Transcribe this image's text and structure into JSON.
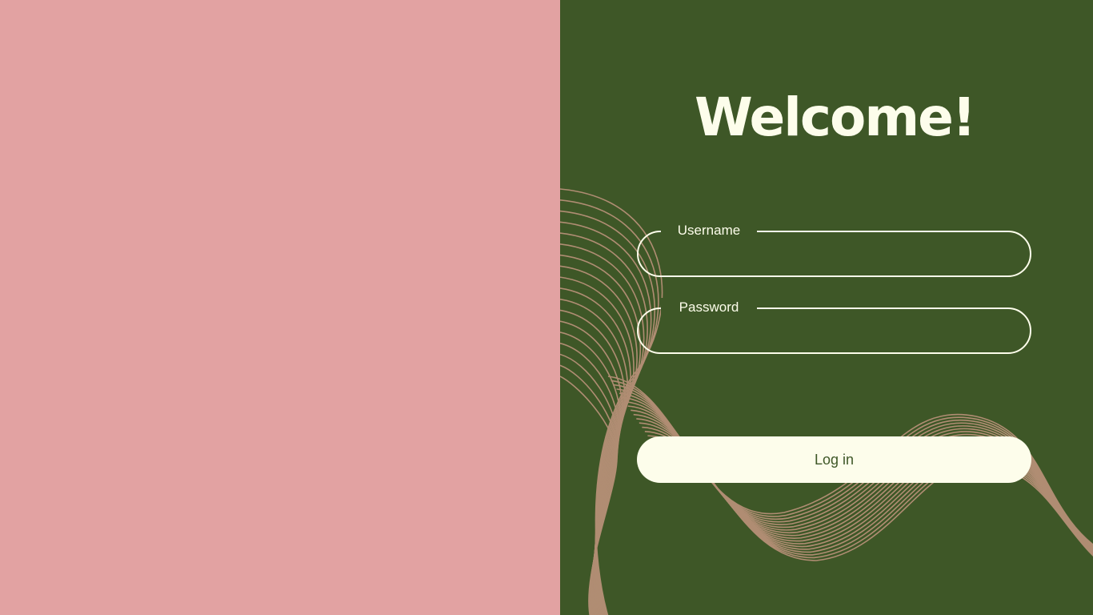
{
  "colors": {
    "left_panel_bg": "#e2a2a2",
    "right_panel_bg": "#3e5727",
    "cream": "#fdfdeb",
    "wave_lines": "#b08d73"
  },
  "decoration": {
    "wave_icon": "wave-lines-pattern"
  },
  "login": {
    "title": "Welcome!",
    "username_label": "Username",
    "username_value": "",
    "password_label": "Password",
    "password_value": "",
    "submit_label": "Log in"
  }
}
